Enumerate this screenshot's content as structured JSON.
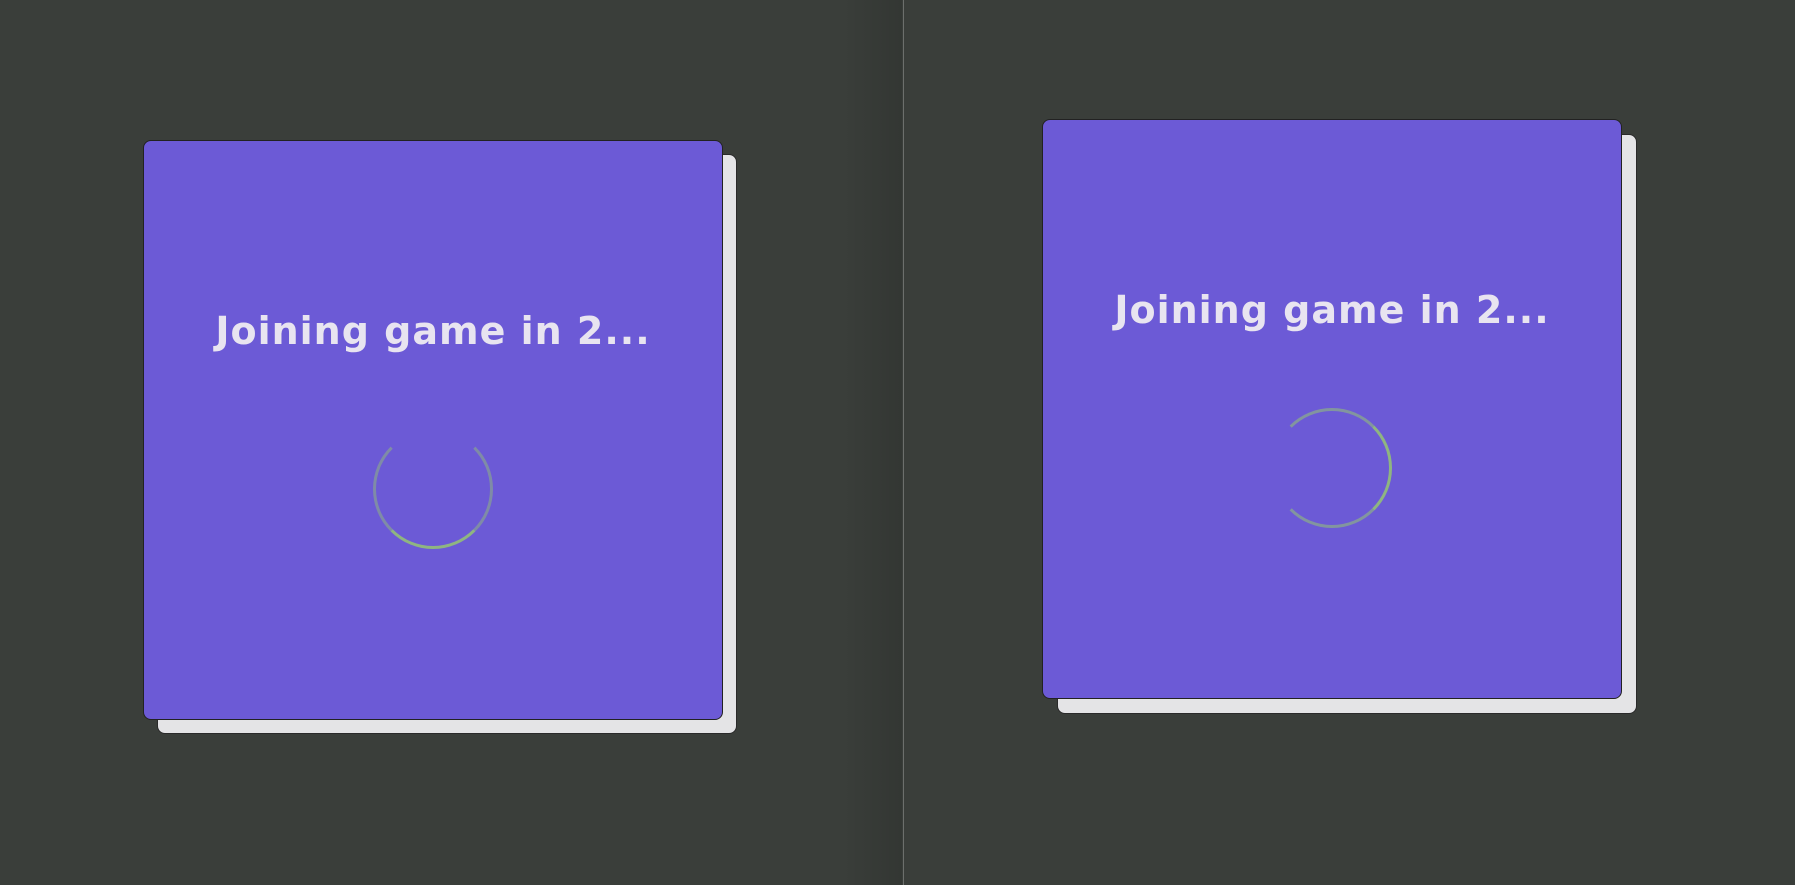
{
  "panes": [
    {
      "title": "Joining game in 2...",
      "spinner_icon": "loading-spinner-icon"
    },
    {
      "title": "Joining game in 2...",
      "spinner_icon": "loading-spinner-icon"
    }
  ],
  "colors": {
    "background": "#3a3e3a",
    "card": "#6c5ad6",
    "card_shadow": "#e4e4e6",
    "title_text": "#e8e4f0",
    "spinner": "#8fb581"
  }
}
